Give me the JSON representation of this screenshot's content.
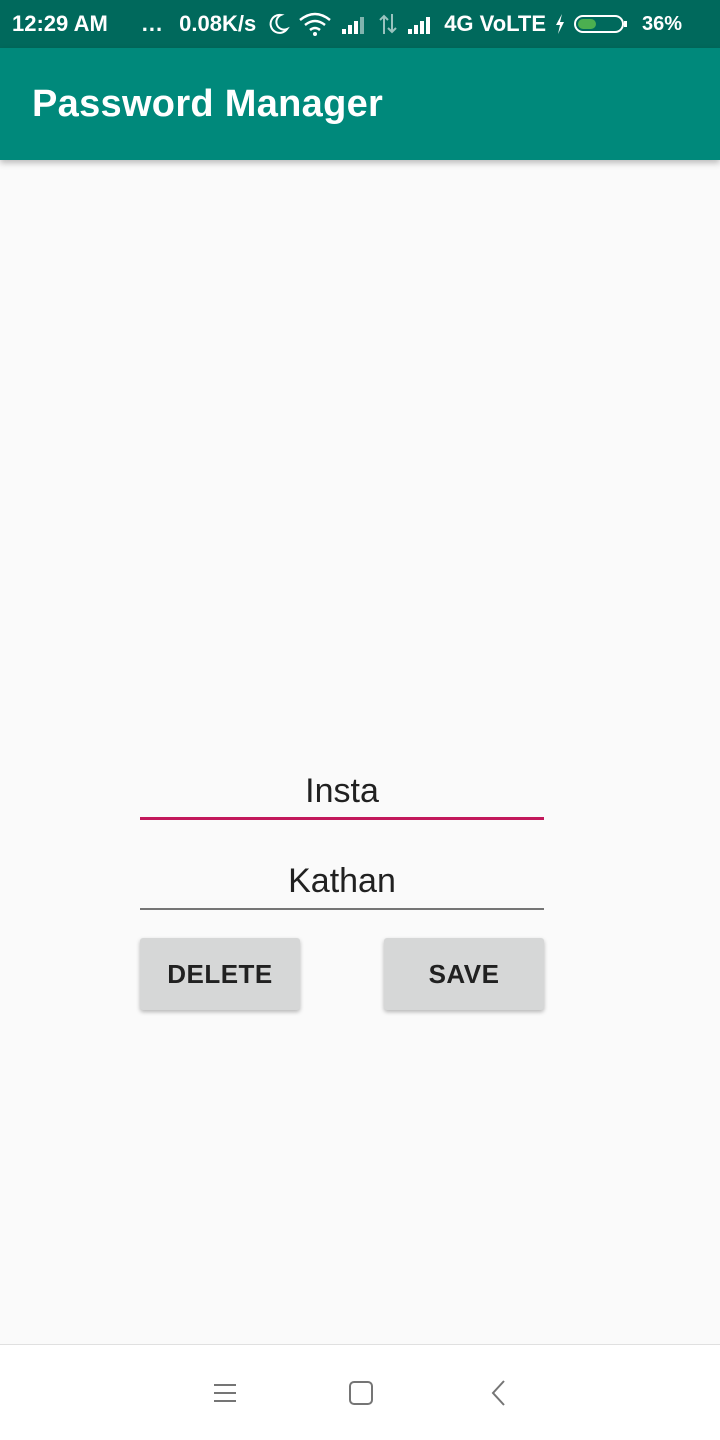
{
  "status_bar": {
    "time": "12:29 AM",
    "dots": "...",
    "speed": "0.08K/s",
    "network": "4G VoLTE",
    "battery": "36%",
    "icons": [
      "moon-icon",
      "wifi-icon",
      "signal-icon",
      "data-arrows-icon",
      "signal-icon",
      "charging-icon",
      "battery-icon"
    ],
    "battery_color": "#4caf50"
  },
  "app_bar": {
    "title": "Password Manager",
    "color": "#00897b"
  },
  "form": {
    "site_value": "Insta",
    "username_value": "Kathan",
    "focused_underline_color": "#c2185b"
  },
  "buttons": {
    "delete_label": "DELETE",
    "save_label": "SAVE"
  },
  "nav_bar": {
    "icons": [
      "menu-icon",
      "home-icon",
      "back-icon"
    ]
  }
}
